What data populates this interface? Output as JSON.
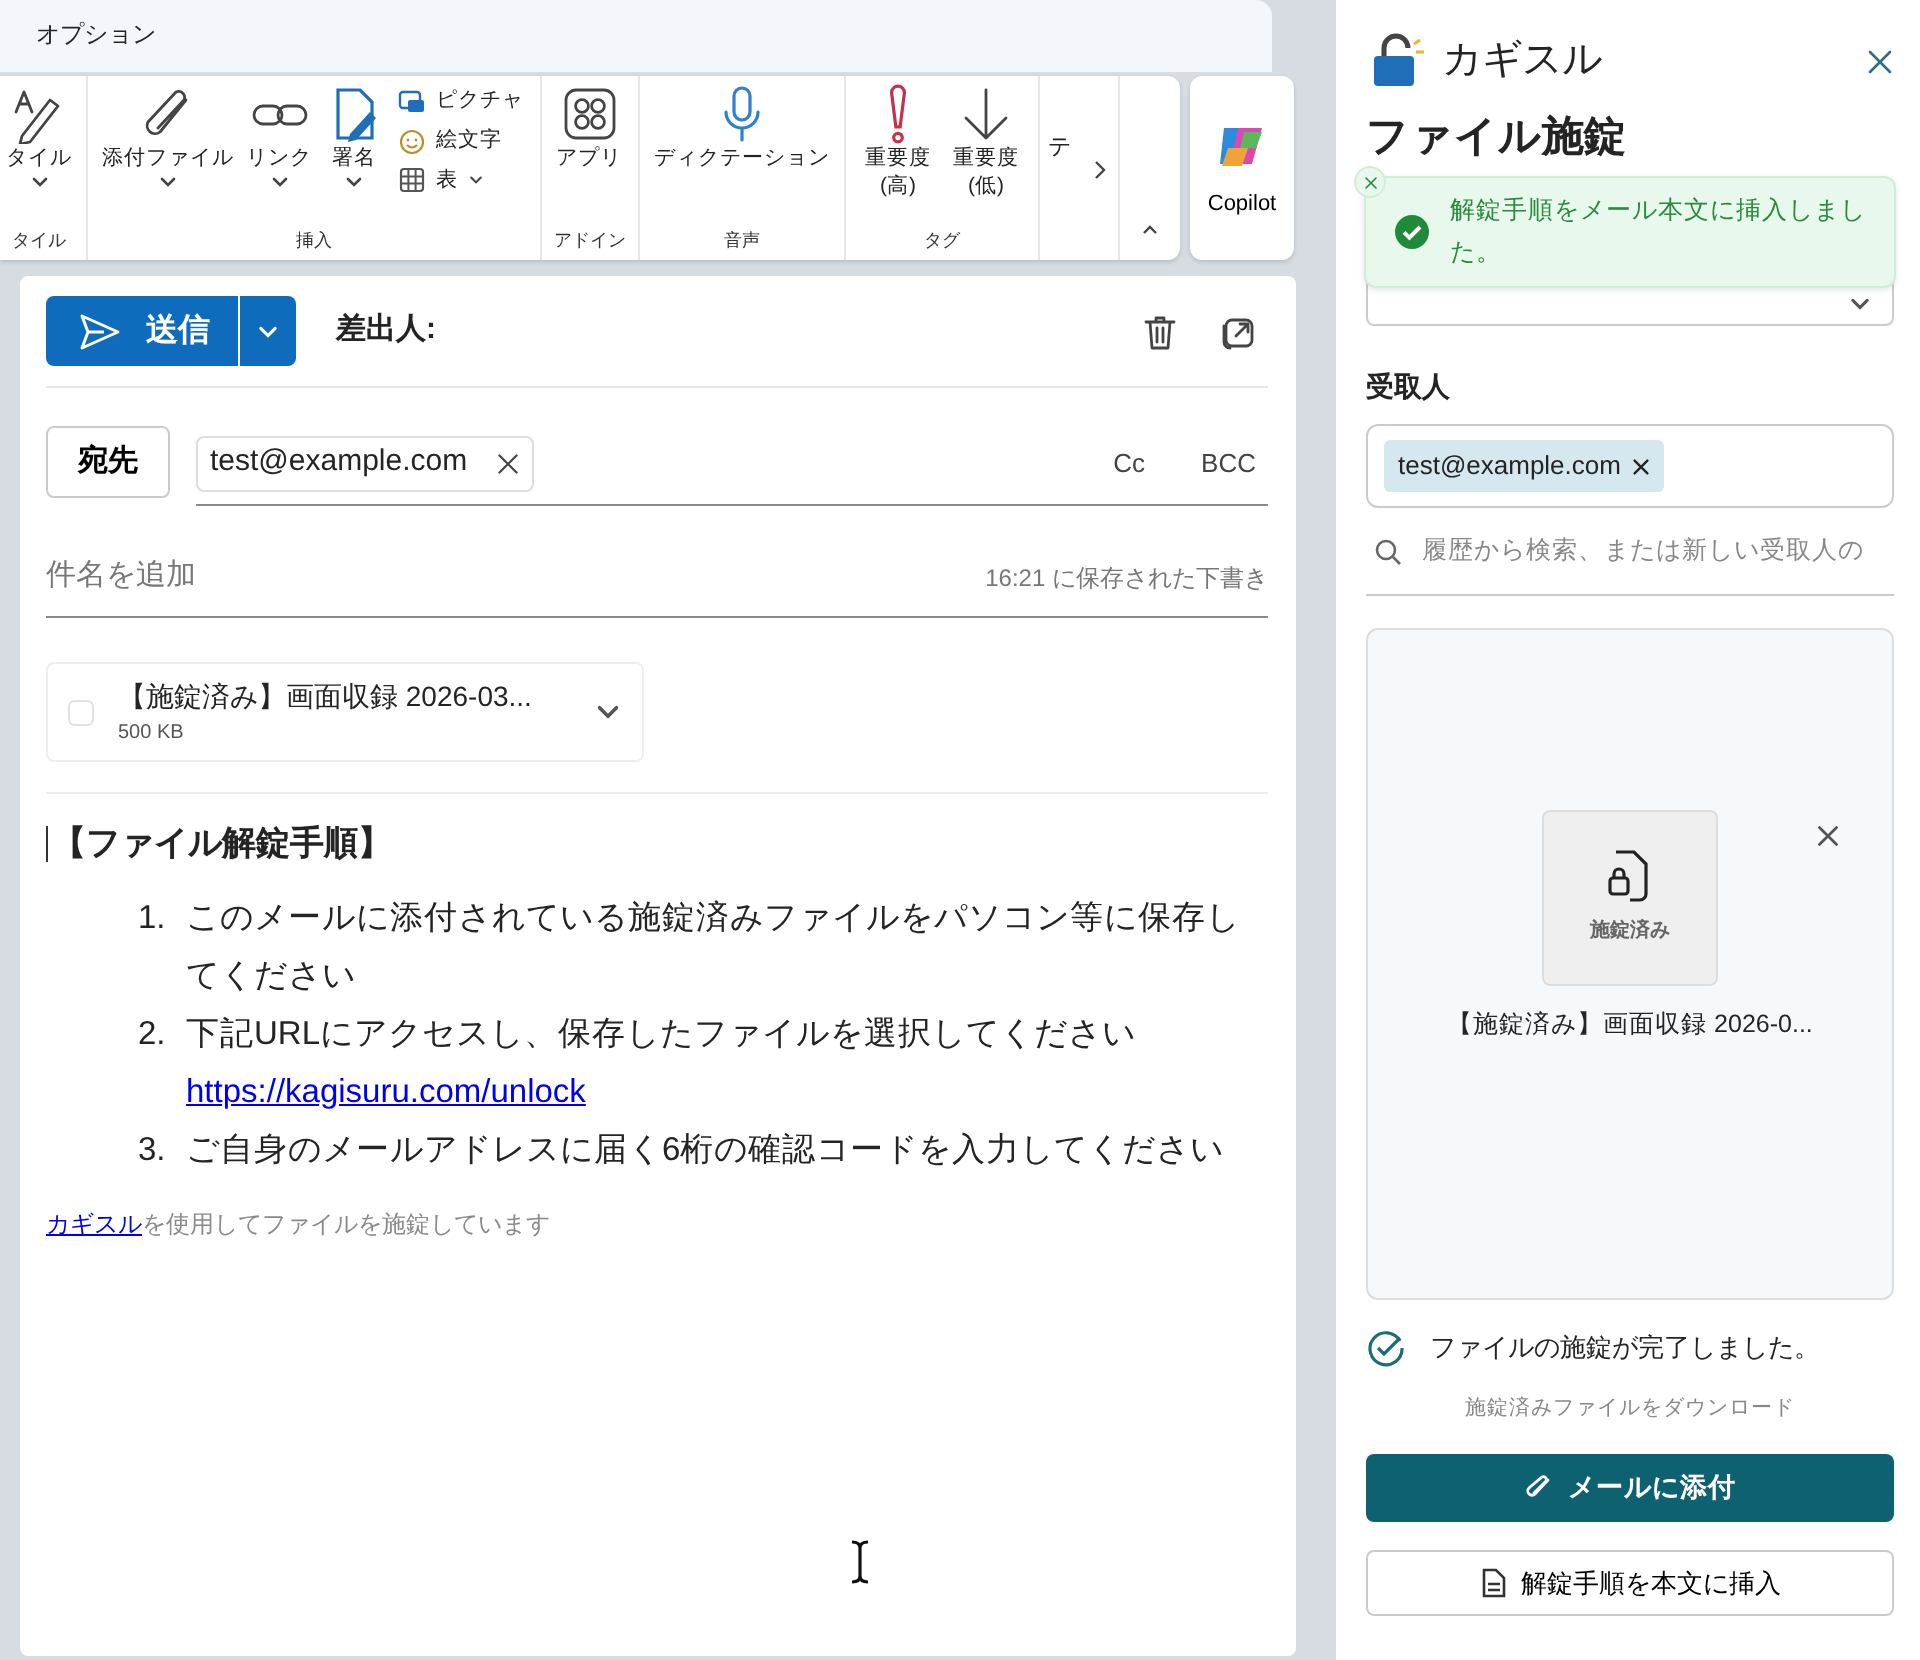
{
  "ribbon": {
    "tab": "オプション",
    "groups": [
      {
        "label": "タイル",
        "buttons": [
          {
            "kind": "large",
            "label": "タイル",
            "dropdown": true
          }
        ]
      },
      {
        "label": "挿入",
        "buttons": [
          {
            "kind": "large",
            "label": "添付ファイル",
            "dropdown": true
          },
          {
            "kind": "large",
            "label": "リンク",
            "dropdown": true
          },
          {
            "kind": "large",
            "label": "署名",
            "dropdown": true
          },
          {
            "kind": "small",
            "label": "ピクチャ",
            "dropdown": false
          },
          {
            "kind": "small",
            "label": "絵文字",
            "dropdown": false
          },
          {
            "kind": "small",
            "label": "表",
            "dropdown": true
          }
        ]
      },
      {
        "label": "アドイン",
        "buttons": [
          {
            "kind": "large",
            "label": "アプリ",
            "dropdown": false
          }
        ]
      },
      {
        "label": "音声",
        "buttons": [
          {
            "kind": "large",
            "label": "ディクテーション",
            "dropdown": false
          }
        ]
      },
      {
        "label": "タグ",
        "buttons": [
          {
            "kind": "large",
            "label": "重要度 (高)",
            "dropdown": false
          },
          {
            "kind": "large",
            "label": "重要度 (低)",
            "dropdown": false
          }
        ]
      }
    ],
    "overflow_text": "テ",
    "copilot": "Copilot"
  },
  "compose": {
    "send": "送信",
    "from_label": "差出人:",
    "to_button": "宛先",
    "recipients": [
      {
        "address": "test@example.com"
      }
    ],
    "cc": "Cc",
    "bcc": "BCC",
    "subject_placeholder": "件名を追加",
    "draft_status": "16:21 に保存された下書き",
    "attachment": {
      "name": "【施錠済み】画面収録 2026-03...",
      "size": "500 KB",
      "checked": false
    },
    "body": {
      "heading": "【ファイル解錠手順】",
      "steps": [
        {
          "number": "1.",
          "text": "このメールに添付されている施錠済みファイルをパソコン等に保存してください"
        },
        {
          "number": "2.",
          "text": "下記URLにアクセスし、保存したファイルを選択してください",
          "link": "https://kagisuru.com/unlock"
        },
        {
          "number": "3.",
          "text": "ご自身のメールアドレスに届く6桁の確認コードを入力してください"
        }
      ],
      "footer_link": "カギスル",
      "footer_text": "を使用してファイルを施錠しています"
    }
  },
  "pane": {
    "title": "カギスル",
    "heading": "ファイル施錠",
    "toast": {
      "message": "解錠手順をメール本文に挿入しました。",
      "kind": "success"
    },
    "recipients_label": "受取人",
    "recipients": [
      {
        "address": "test@example.com"
      }
    ],
    "search_placeholder": "履歴から検索、または新しい受取人の",
    "file": {
      "thumb_label": "施錠済み",
      "name": "【施錠済み】画面収録 2026-0..."
    },
    "status": "ファイルの施錠が完了しました。",
    "download_link": "施錠済みファイルをダウンロード",
    "attach_button": "メールに添付",
    "insert_button": "解錠手順を本文に挿入"
  }
}
